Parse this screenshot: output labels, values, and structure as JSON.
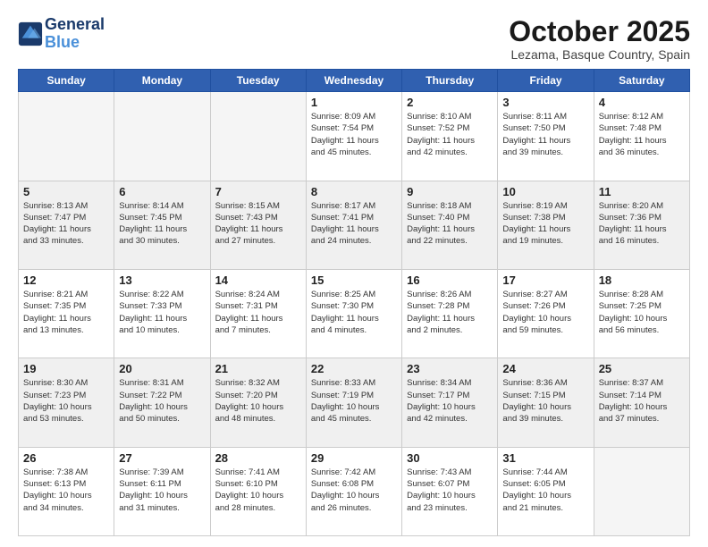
{
  "header": {
    "logo_line1": "General",
    "logo_line2": "Blue",
    "month_title": "October 2025",
    "location": "Lezama, Basque Country, Spain"
  },
  "days_of_week": [
    "Sunday",
    "Monday",
    "Tuesday",
    "Wednesday",
    "Thursday",
    "Friday",
    "Saturday"
  ],
  "weeks": [
    [
      {
        "day": "",
        "info": ""
      },
      {
        "day": "",
        "info": ""
      },
      {
        "day": "",
        "info": ""
      },
      {
        "day": "1",
        "info": "Sunrise: 8:09 AM\nSunset: 7:54 PM\nDaylight: 11 hours\nand 45 minutes."
      },
      {
        "day": "2",
        "info": "Sunrise: 8:10 AM\nSunset: 7:52 PM\nDaylight: 11 hours\nand 42 minutes."
      },
      {
        "day": "3",
        "info": "Sunrise: 8:11 AM\nSunset: 7:50 PM\nDaylight: 11 hours\nand 39 minutes."
      },
      {
        "day": "4",
        "info": "Sunrise: 8:12 AM\nSunset: 7:48 PM\nDaylight: 11 hours\nand 36 minutes."
      }
    ],
    [
      {
        "day": "5",
        "info": "Sunrise: 8:13 AM\nSunset: 7:47 PM\nDaylight: 11 hours\nand 33 minutes."
      },
      {
        "day": "6",
        "info": "Sunrise: 8:14 AM\nSunset: 7:45 PM\nDaylight: 11 hours\nand 30 minutes."
      },
      {
        "day": "7",
        "info": "Sunrise: 8:15 AM\nSunset: 7:43 PM\nDaylight: 11 hours\nand 27 minutes."
      },
      {
        "day": "8",
        "info": "Sunrise: 8:17 AM\nSunset: 7:41 PM\nDaylight: 11 hours\nand 24 minutes."
      },
      {
        "day": "9",
        "info": "Sunrise: 8:18 AM\nSunset: 7:40 PM\nDaylight: 11 hours\nand 22 minutes."
      },
      {
        "day": "10",
        "info": "Sunrise: 8:19 AM\nSunset: 7:38 PM\nDaylight: 11 hours\nand 19 minutes."
      },
      {
        "day": "11",
        "info": "Sunrise: 8:20 AM\nSunset: 7:36 PM\nDaylight: 11 hours\nand 16 minutes."
      }
    ],
    [
      {
        "day": "12",
        "info": "Sunrise: 8:21 AM\nSunset: 7:35 PM\nDaylight: 11 hours\nand 13 minutes."
      },
      {
        "day": "13",
        "info": "Sunrise: 8:22 AM\nSunset: 7:33 PM\nDaylight: 11 hours\nand 10 minutes."
      },
      {
        "day": "14",
        "info": "Sunrise: 8:24 AM\nSunset: 7:31 PM\nDaylight: 11 hours\nand 7 minutes."
      },
      {
        "day": "15",
        "info": "Sunrise: 8:25 AM\nSunset: 7:30 PM\nDaylight: 11 hours\nand 4 minutes."
      },
      {
        "day": "16",
        "info": "Sunrise: 8:26 AM\nSunset: 7:28 PM\nDaylight: 11 hours\nand 2 minutes."
      },
      {
        "day": "17",
        "info": "Sunrise: 8:27 AM\nSunset: 7:26 PM\nDaylight: 10 hours\nand 59 minutes."
      },
      {
        "day": "18",
        "info": "Sunrise: 8:28 AM\nSunset: 7:25 PM\nDaylight: 10 hours\nand 56 minutes."
      }
    ],
    [
      {
        "day": "19",
        "info": "Sunrise: 8:30 AM\nSunset: 7:23 PM\nDaylight: 10 hours\nand 53 minutes."
      },
      {
        "day": "20",
        "info": "Sunrise: 8:31 AM\nSunset: 7:22 PM\nDaylight: 10 hours\nand 50 minutes."
      },
      {
        "day": "21",
        "info": "Sunrise: 8:32 AM\nSunset: 7:20 PM\nDaylight: 10 hours\nand 48 minutes."
      },
      {
        "day": "22",
        "info": "Sunrise: 8:33 AM\nSunset: 7:19 PM\nDaylight: 10 hours\nand 45 minutes."
      },
      {
        "day": "23",
        "info": "Sunrise: 8:34 AM\nSunset: 7:17 PM\nDaylight: 10 hours\nand 42 minutes."
      },
      {
        "day": "24",
        "info": "Sunrise: 8:36 AM\nSunset: 7:15 PM\nDaylight: 10 hours\nand 39 minutes."
      },
      {
        "day": "25",
        "info": "Sunrise: 8:37 AM\nSunset: 7:14 PM\nDaylight: 10 hours\nand 37 minutes."
      }
    ],
    [
      {
        "day": "26",
        "info": "Sunrise: 7:38 AM\nSunset: 6:13 PM\nDaylight: 10 hours\nand 34 minutes."
      },
      {
        "day": "27",
        "info": "Sunrise: 7:39 AM\nSunset: 6:11 PM\nDaylight: 10 hours\nand 31 minutes."
      },
      {
        "day": "28",
        "info": "Sunrise: 7:41 AM\nSunset: 6:10 PM\nDaylight: 10 hours\nand 28 minutes."
      },
      {
        "day": "29",
        "info": "Sunrise: 7:42 AM\nSunset: 6:08 PM\nDaylight: 10 hours\nand 26 minutes."
      },
      {
        "day": "30",
        "info": "Sunrise: 7:43 AM\nSunset: 6:07 PM\nDaylight: 10 hours\nand 23 minutes."
      },
      {
        "day": "31",
        "info": "Sunrise: 7:44 AM\nSunset: 6:05 PM\nDaylight: 10 hours\nand 21 minutes."
      },
      {
        "day": "",
        "info": ""
      }
    ]
  ]
}
